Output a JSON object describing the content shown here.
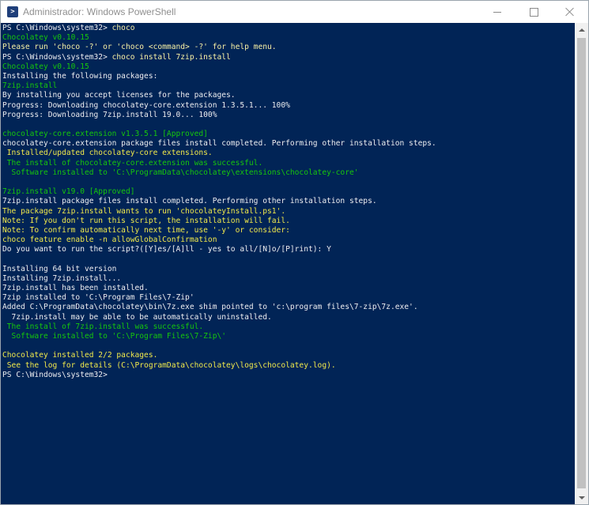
{
  "window": {
    "title": "Administrador: Windows PowerShell",
    "icon": "powershell-icon",
    "icon_glyph": ">",
    "controls": [
      "minimize-icon",
      "maximize-icon",
      "close-icon"
    ]
  },
  "colors": {
    "console_background": "#012456",
    "text_default": "#eeedf0",
    "text_green": "#16c60c",
    "text_yellow": "#f9f1a5"
  },
  "console": {
    "lines": [
      {
        "text": "PS C:\\Windows\\system32> ",
        "cmd": "choco",
        "color": "white"
      },
      {
        "text": "Chocolatey v0.10.15",
        "color": "green"
      },
      {
        "text": "Please run 'choco -?' or 'choco <command> -?' for help menu.",
        "color": "yellow"
      },
      {
        "text": "PS C:\\Windows\\system32> ",
        "cmd": "choco install 7zip.install",
        "color": "white"
      },
      {
        "text": "Chocolatey v0.10.15",
        "color": "green"
      },
      {
        "text": "Installing the following packages:",
        "color": "white"
      },
      {
        "text": "7zip.install",
        "color": "green"
      },
      {
        "text": "By installing you accept licenses for the packages.",
        "color": "white"
      },
      {
        "text": "Progress: Downloading chocolatey-core.extension 1.3.5.1... 100%",
        "color": "white"
      },
      {
        "text": "Progress: Downloading 7zip.install 19.0... 100%",
        "color": "white"
      },
      {
        "text": "",
        "color": "white"
      },
      {
        "text": "chocolatey-core.extension v1.3.5.1 [Approved]",
        "color": "green"
      },
      {
        "text": "chocolatey-core.extension package files install completed. Performing other installation steps.",
        "color": "white"
      },
      {
        "text": " Installed/updated chocolatey-core extensions.",
        "color": "yellow2"
      },
      {
        "text": " The install of chocolatey-core.extension was successful.",
        "color": "green"
      },
      {
        "text": "  Software installed to 'C:\\ProgramData\\chocolatey\\extensions\\chocolatey-core'",
        "color": "green"
      },
      {
        "text": "",
        "color": "white"
      },
      {
        "text": "7zip.install v19.0 [Approved]",
        "color": "green"
      },
      {
        "text": "7zip.install package files install completed. Performing other installation steps.",
        "color": "white"
      },
      {
        "text": "The package 7zip.install wants to run 'chocolateyInstall.ps1'.",
        "color": "yellow2"
      },
      {
        "text": "Note: If you don't run this script, the installation will fail.",
        "color": "yellow2"
      },
      {
        "text": "Note: To confirm automatically next time, use '-y' or consider:",
        "color": "yellow2"
      },
      {
        "text": "choco feature enable -n allowGlobalConfirmation",
        "color": "yellow2"
      },
      {
        "text": "Do you want to run the script?([Y]es/[A]ll - yes to all/[N]o/[P]rint): Y",
        "color": "white"
      },
      {
        "text": "",
        "color": "white"
      },
      {
        "text": "Installing 64 bit version",
        "color": "white"
      },
      {
        "text": "Installing 7zip.install...",
        "color": "white"
      },
      {
        "text": "7zip.install has been installed.",
        "color": "white"
      },
      {
        "text": "7zip installed to 'C:\\Program Files\\7-Zip'",
        "color": "white"
      },
      {
        "text": "Added C:\\ProgramData\\chocolatey\\bin\\7z.exe shim pointed to 'c:\\program files\\7-zip\\7z.exe'.",
        "color": "white"
      },
      {
        "text": "  7zip.install may be able to be automatically uninstalled.",
        "color": "white"
      },
      {
        "text": " The install of 7zip.install was successful.",
        "color": "green"
      },
      {
        "text": "  Software installed to 'C:\\Program Files\\7-Zip\\'",
        "color": "green"
      },
      {
        "text": "",
        "color": "white"
      },
      {
        "text": "Chocolatey installed 2/2 packages.",
        "color": "yellow2"
      },
      {
        "text": " See the log for details (C:\\ProgramData\\chocolatey\\logs\\chocolatey.log).",
        "color": "yellow2"
      },
      {
        "text": "PS C:\\Windows\\system32> ",
        "color": "white"
      }
    ]
  }
}
